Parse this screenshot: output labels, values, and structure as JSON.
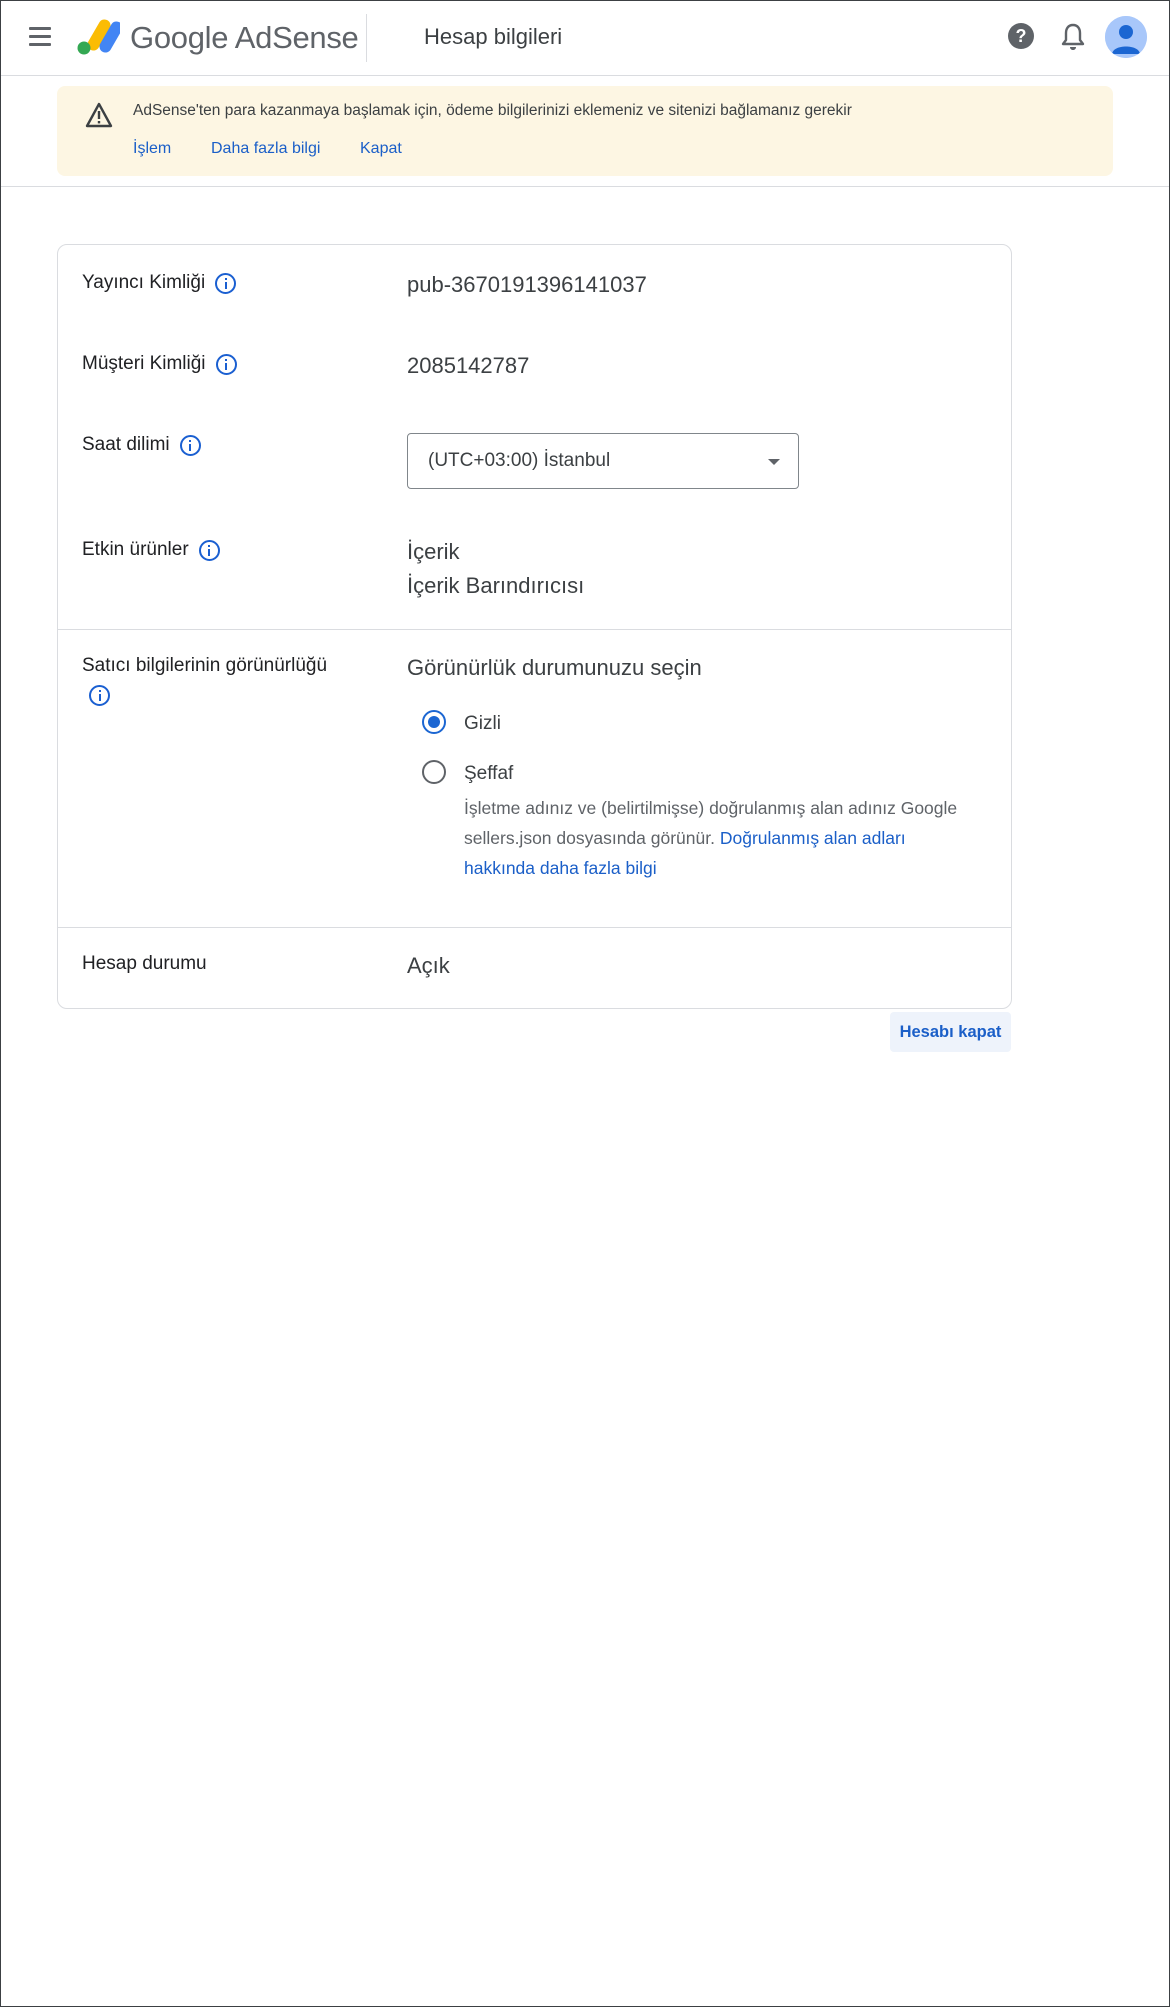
{
  "header": {
    "brand": "Google AdSense",
    "page_title": "Hesap bilgileri"
  },
  "alert": {
    "message": "AdSense'ten para kazanmaya başlamak için, ödeme bilgilerinizi eklemeniz ve sitenizi bağlamanız gerekir",
    "links": [
      "İşlem",
      "Daha fazla bilgi",
      "Kapat"
    ]
  },
  "account": {
    "publisher_id_label": "Yayıncı Kimliği",
    "publisher_id": "pub-3670191396141037",
    "customer_id_label": "Müşteri Kimliği",
    "customer_id": "2085142787",
    "timezone_label": "Saat dilimi",
    "timezone": "(UTC+03:00) İstanbul",
    "products_label": "Etkin ürünler",
    "products": [
      "İçerik",
      "İçerik Barındırıcısı"
    ],
    "seller_visibility_label": "Satıcı bilgilerinin görünürlüğü",
    "visibility_prompt": "Görünürlük durumunuzu seçin",
    "visibility_options": [
      {
        "label": "Gizli",
        "selected": true
      },
      {
        "label": "Şeffaf",
        "selected": false
      }
    ],
    "transparent_desc": "İşletme adınız ve (belirtilmişse) doğrulanmış alan adınız Google sellers.json dosyasında görünür.",
    "transparent_link": "Doğrulanmış alan adları hakkında daha fazla bilgi",
    "status_label": "Hesap durumu",
    "status": "Açık"
  },
  "close_account_label": "Hesabı kapat",
  "icons": {
    "menu": "menu-icon",
    "help": "help-icon",
    "notifications": "bell-icon",
    "avatar": "avatar-icon",
    "warning": "warning-icon",
    "info": "info-icon",
    "dropdown": "caret-down-icon"
  },
  "colors": {
    "link": "#1b5fc8",
    "alert_bg": "#fdf6e3",
    "radio_selected": "#1b66d2"
  }
}
